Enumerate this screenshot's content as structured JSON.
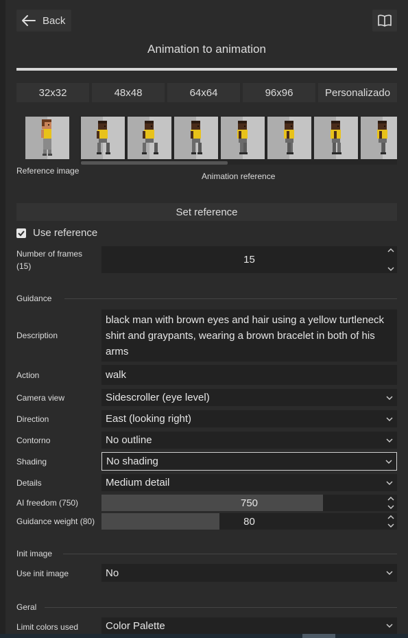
{
  "header": {
    "back_label": "Back",
    "title": "Animation to animation"
  },
  "sizes": [
    "32x32",
    "48x48",
    "64x64",
    "96x96",
    "Personalizado"
  ],
  "reference": {
    "reference_caption": "Reference image",
    "animation_caption": "Animation reference",
    "set_reference_label": "Set reference",
    "use_reference_label": "Use reference",
    "use_reference_checked": true
  },
  "frames": {
    "label": "Number of frames (15)",
    "value": "15"
  },
  "guidance": {
    "section_title": "Guidance",
    "description_label": "Description",
    "description_value": "black man with brown eyes and hair using a yellow turtleneck shirt and graypants, wearing a brown bracelet in both of his arms",
    "action_label": "Action",
    "action_value": "walk",
    "camera_label": "Camera view",
    "camera_value": "Sidescroller (eye level)",
    "direction_label": "Direction",
    "direction_value": "East (looking right)",
    "outline_label": "Contorno",
    "outline_value": "No outline",
    "shading_label": "Shading",
    "shading_value": "No shading",
    "details_label": "Details",
    "details_value": "Medium detail",
    "ai_freedom_label": "AI freedom (750)",
    "ai_freedom_value": "750",
    "ai_freedom_fraction": 0.75,
    "guidance_weight_label": "Guidance weight (80)",
    "guidance_weight_value": "80",
    "guidance_weight_fraction": 0.4
  },
  "init_image": {
    "section_title": "Init image",
    "use_init_label": "Use init image",
    "use_init_value": "No"
  },
  "geral": {
    "section_title": "Geral",
    "limit_colors_label": "Limit colors used",
    "limit_colors_value": "Color Palette"
  },
  "colors": {
    "background": "#2b2b2b",
    "field": "#222222",
    "button": "#333333",
    "shirt": "#e8c21a",
    "skin_dark": "#4a2c1a",
    "skin_light": "#c8845a"
  }
}
